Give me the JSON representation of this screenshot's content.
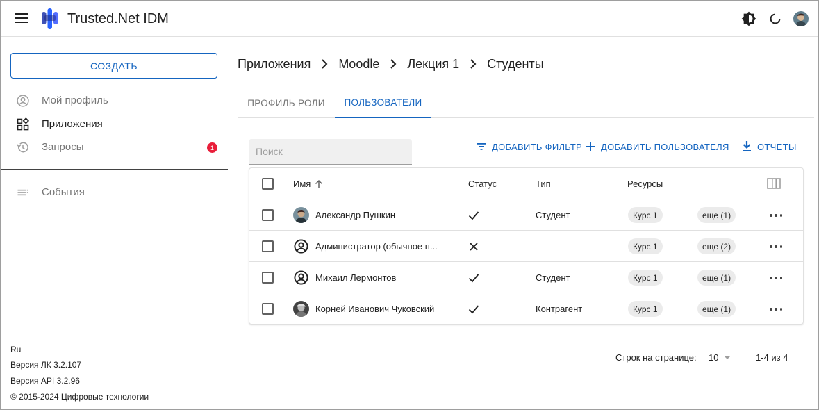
{
  "header": {
    "app_title": "Trusted.Net IDM",
    "icons": [
      "menu-icon",
      "theme-brightness-icon",
      "refresh-icon",
      "user-avatar"
    ]
  },
  "sidebar": {
    "create_label": "СОЗДАТЬ",
    "items": [
      {
        "label": "Мой профиль",
        "icon": "account-circle-icon"
      },
      {
        "label": "Приложения",
        "icon": "apps-icon"
      },
      {
        "label": "Запросы",
        "icon": "history-icon",
        "badge": "1"
      },
      {
        "label": "События",
        "icon": "event-list-icon"
      }
    ],
    "footer": {
      "lang": "Ru",
      "version_lk": "Версия ЛК 3.2.107",
      "version_api": "Версия API 3.2.96",
      "copyright": "© 2015-2024 Цифровые технологии"
    }
  },
  "breadcrumb": [
    "Приложения",
    "Moodle",
    "Лекция 1",
    "Студенты"
  ],
  "tabs": [
    {
      "label": "ПРОФИЛЬ РОЛИ",
      "active": false
    },
    {
      "label": "ПОЛЬЗОВАТЕЛИ",
      "active": true
    }
  ],
  "toolbar": {
    "search_placeholder": "Поиск",
    "add_filter": "ДОБАВИТЬ ФИЛЬТР",
    "add_user": "ДОБАВИТЬ ПОЛЬЗОВАТЕЛЯ",
    "reports": "ОТЧЕТЫ"
  },
  "table": {
    "columns": [
      "Имя",
      "Статус",
      "Тип",
      "Ресурсы"
    ],
    "rows": [
      {
        "name": "Александр Пушкин",
        "status": "check",
        "type": "Студент",
        "resource": "Курс 1",
        "more": "еще (1)",
        "avatar": "photo"
      },
      {
        "name": "Администратор (обычное п...",
        "status": "cross",
        "type": "",
        "resource": "Курс 1",
        "more": "еще (2)",
        "avatar": "account-icon"
      },
      {
        "name": "Михаил Лермонтов",
        "status": "check",
        "type": "Студент",
        "resource": "Курс 1",
        "more": "еще (1)",
        "avatar": "account-icon"
      },
      {
        "name": "Корней Иванович Чуковский",
        "status": "check",
        "type": "Контрагент",
        "resource": "Курс 1",
        "more": "еще (1)",
        "avatar": "photo"
      }
    ]
  },
  "pagination": {
    "rows_label": "Строк на странице:",
    "rows_value": "10",
    "range": "1-4 из 4"
  },
  "colors": {
    "accent": "#1565c0",
    "badge": "#e91e3a"
  }
}
